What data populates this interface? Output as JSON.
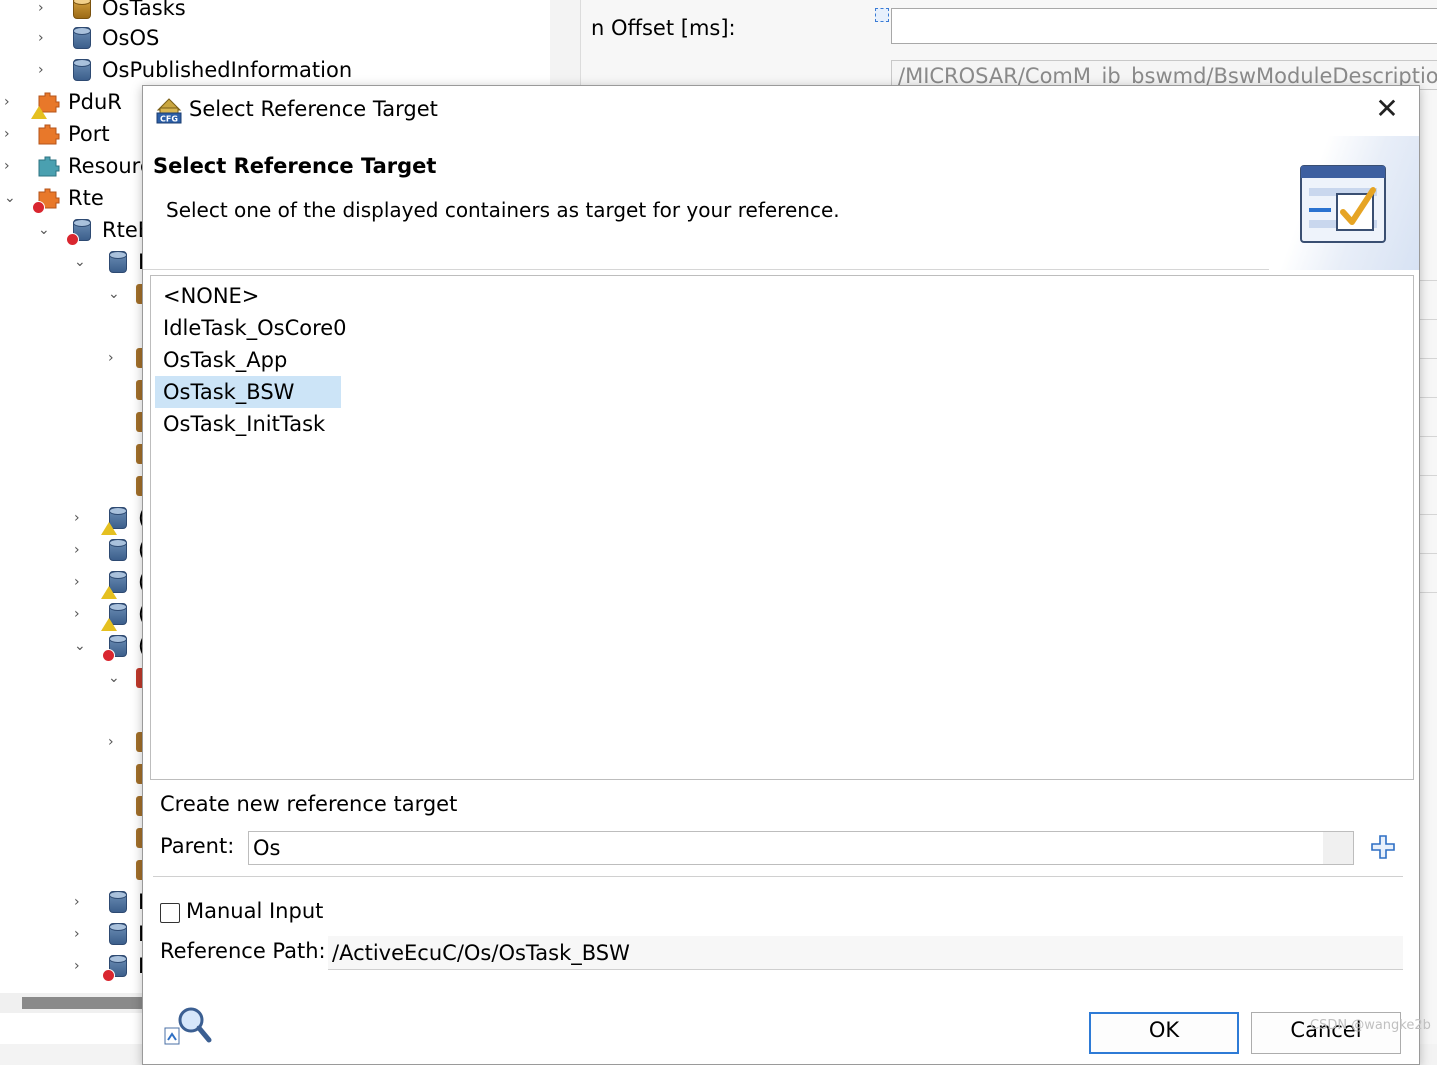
{
  "tree": {
    "items": [
      {
        "label": "OsTasks"
      },
      {
        "label": "OsOS"
      },
      {
        "label": "OsPublishedInformation"
      },
      {
        "label": "PduR"
      },
      {
        "label": "Port"
      },
      {
        "label": "Resourc"
      },
      {
        "label": "Rte"
      },
      {
        "label": "RteE"
      },
      {
        "label": "E"
      },
      {
        "label": "("
      },
      {
        "label": "("
      },
      {
        "label": "("
      },
      {
        "label": "("
      },
      {
        "label": "("
      },
      {
        "label": "D"
      },
      {
        "label": "D"
      },
      {
        "label": "E"
      }
    ]
  },
  "properties": {
    "offset_label": "n Offset [ms]:",
    "path_value": "/MICROSAR/ComM_ib_bswmd/BswModuleDescriptio"
  },
  "dialog": {
    "title": "Select Reference Target",
    "header_title": "Select Reference Target",
    "header_description": "Select one of the displayed containers as target for your reference.",
    "list_items": [
      {
        "label": "<NONE>"
      },
      {
        "label": "IdleTask_OsCore0"
      },
      {
        "label": "OsTask_App"
      },
      {
        "label": "OsTask_BSW"
      },
      {
        "label": "OsTask_InitTask"
      }
    ],
    "selected_item": "OsTask_BSW",
    "create_label": "Create new reference target",
    "parent_label": "Parent:",
    "parent_value": "Os",
    "manual_input_label": "Manual Input",
    "manual_input_checked": false,
    "reference_path_label": "Reference Path:",
    "reference_path_value": "/ActiveEcuC/Os/OsTask_BSW",
    "ok_label": "OK",
    "cancel_label": "Cancel"
  },
  "watermark": "CSDN @wangke2b",
  "colors": {
    "selection": "#cce4f7",
    "accent": "#2e7bd6"
  }
}
